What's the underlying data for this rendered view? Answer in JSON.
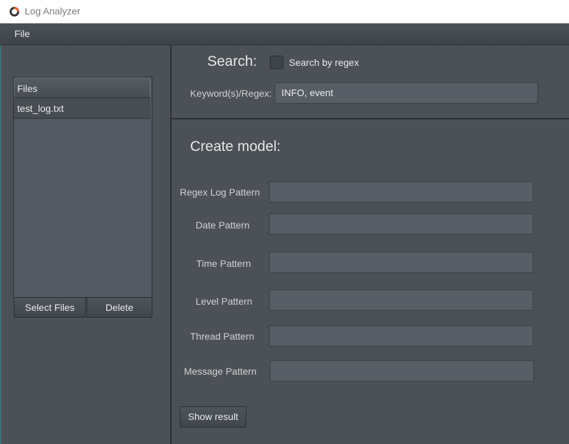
{
  "window": {
    "title": "Log Analyzer",
    "icon": "app-ring-icon"
  },
  "menu": {
    "file": "File"
  },
  "files": {
    "header": "Files",
    "items": [
      "test_log.txt"
    ],
    "select_button": "Select Files",
    "delete_button": "Delete"
  },
  "search": {
    "title": "Search:",
    "regex_checkbox_label": "Search by regex",
    "regex_checked": false,
    "keyword_label": "Keyword(s)/Regex:",
    "keyword_value": "INFO, event"
  },
  "model": {
    "title": "Create model:",
    "fields": [
      {
        "label": "Regex Log Pattern",
        "value": ""
      },
      {
        "label": "Date Pattern",
        "value": ""
      },
      {
        "label": "Time Pattern",
        "value": ""
      },
      {
        "label": "Level Pattern",
        "value": ""
      },
      {
        "label": "Thread Pattern",
        "value": ""
      },
      {
        "label": "Message Pattern",
        "value": ""
      }
    ],
    "show_result_button": "Show result"
  },
  "colors": {
    "background": "#4b5157",
    "input": "#575e65",
    "border": "#2a2e32",
    "accent_orange": "#e8622c"
  }
}
